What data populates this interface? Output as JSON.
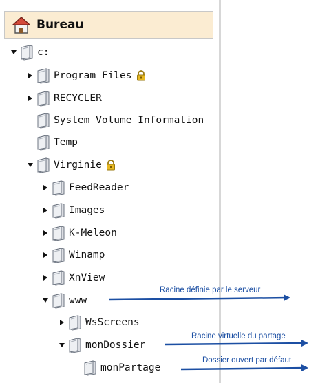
{
  "header": {
    "title": "Bureau",
    "icon": "home-icon"
  },
  "tree": [
    {
      "label": "c:",
      "caret": "open",
      "locked": false
    },
    {
      "label": "Program Files",
      "caret": "closed",
      "locked": true
    },
    {
      "label": "RECYCLER",
      "caret": "closed",
      "locked": false
    },
    {
      "label": "System Volume Information",
      "caret": "none",
      "locked": false
    },
    {
      "label": "Temp",
      "caret": "none",
      "locked": false
    },
    {
      "label": "Virginie",
      "caret": "open",
      "locked": true
    },
    {
      "label": "FeedReader",
      "caret": "closed",
      "locked": false
    },
    {
      "label": "Images",
      "caret": "closed",
      "locked": false
    },
    {
      "label": "K-Meleon",
      "caret": "closed",
      "locked": false
    },
    {
      "label": "Winamp",
      "caret": "closed",
      "locked": false
    },
    {
      "label": "XnView",
      "caret": "closed",
      "locked": false
    },
    {
      "label": "www",
      "caret": "open",
      "locked": false
    },
    {
      "label": "WsScreens",
      "caret": "closed",
      "locked": false
    },
    {
      "label": "monDossier",
      "caret": "open",
      "locked": false
    },
    {
      "label": "monPartage",
      "caret": "none",
      "locked": false
    }
  ],
  "annotations": [
    {
      "text": "Racine définie par le serveur"
    },
    {
      "text": "Racine virtuelle du partage"
    },
    {
      "text": "Dossier ouvert par défaut"
    }
  ],
  "colors": {
    "header_bg": "#fbecd2",
    "annotation": "#1c4fa3",
    "lock": "#e8b923"
  }
}
